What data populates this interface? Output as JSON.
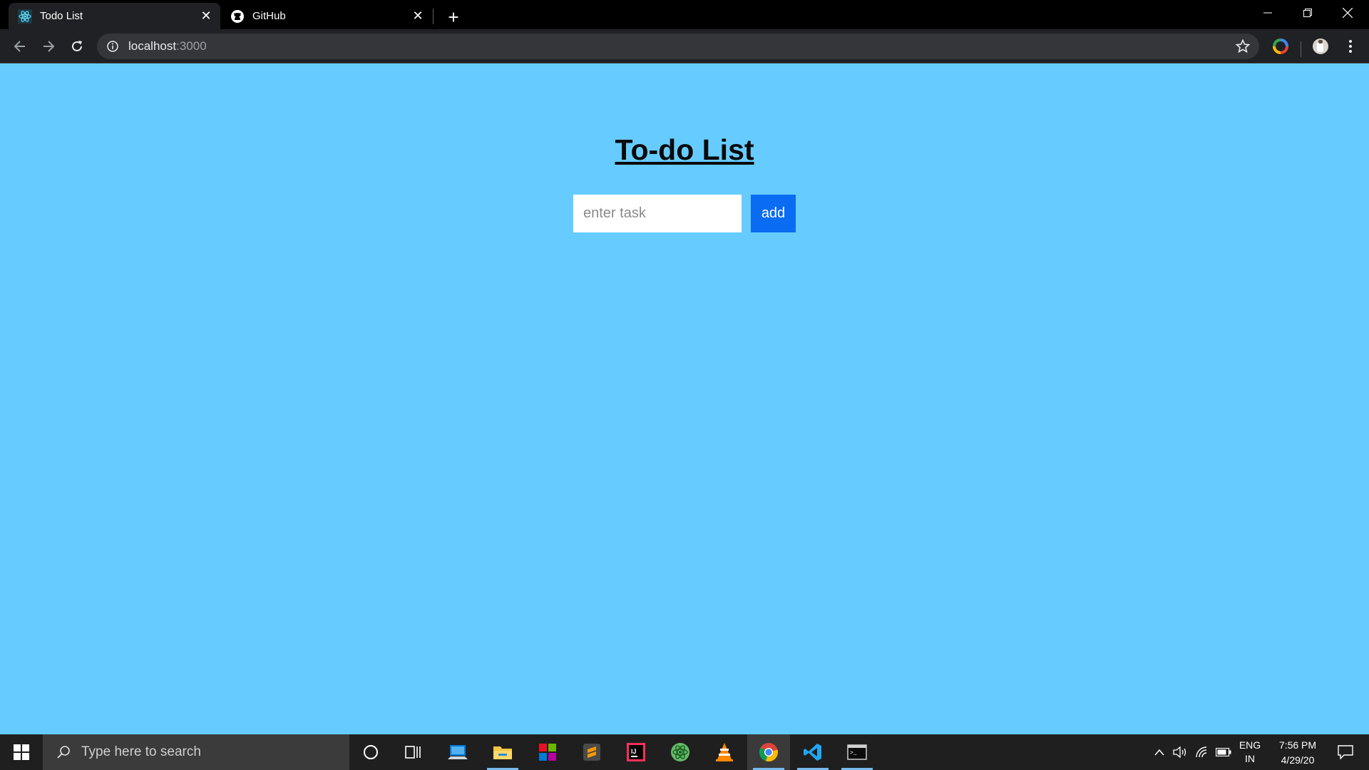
{
  "browser": {
    "tabs": [
      {
        "title": "Todo List",
        "icon": "react-icon",
        "active": true
      },
      {
        "title": "GitHub",
        "icon": "github-icon",
        "active": false
      }
    ],
    "address": {
      "host": "localhost",
      "port": ":3000"
    }
  },
  "page": {
    "title": "To-do List",
    "task_input": {
      "placeholder": "enter task",
      "value": ""
    },
    "add_button_label": "add",
    "background_color": "#66ccff",
    "button_color": "#0a6cf2"
  },
  "taskbar": {
    "search_placeholder": "Type here to search",
    "apps": [
      "cortana-icon",
      "task-view-icon",
      "remote-desktop-icon",
      "file-explorer-icon",
      "office-icon",
      "sublime-text-icon",
      "intellij-icon",
      "atom-icon",
      "vlc-icon",
      "chrome-icon",
      "vscode-icon",
      "terminal-icon"
    ],
    "language": {
      "line1": "ENG",
      "line2": "IN"
    },
    "time": "7:56 PM",
    "date": "4/29/20"
  }
}
